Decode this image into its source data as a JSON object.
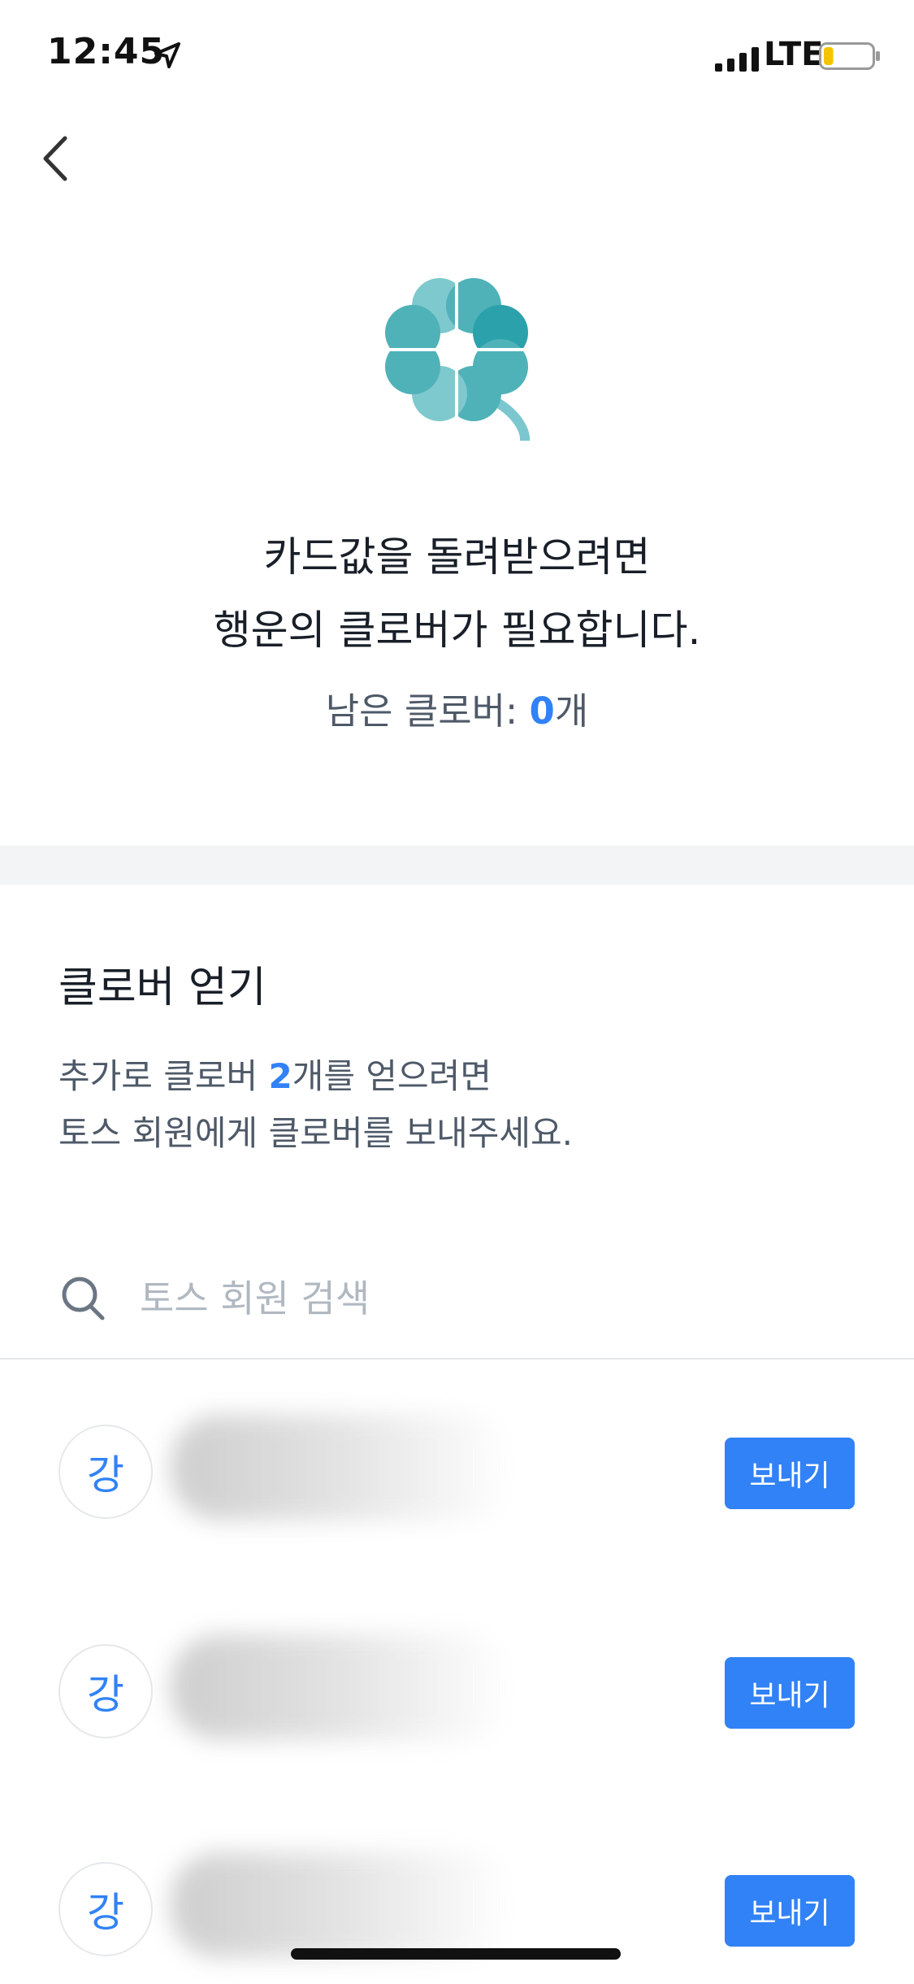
{
  "status_bar": {
    "time": "12:45",
    "network": "LTE",
    "location_icon": "location-arrow-icon",
    "battery_level": 0.2
  },
  "nav": {
    "back_icon": "chevron-left-icon"
  },
  "hero": {
    "icon": "clover-icon",
    "headline_line1": "카드값을 돌려받으려면",
    "headline_line2": "행운의 클로버가 필요합니다.",
    "remaining_label": "남은 클로버: ",
    "remaining_count": "0",
    "remaining_unit": "개"
  },
  "section": {
    "title": "클로버 얻기",
    "desc_line1_prefix": "추가로 클로버 ",
    "desc_line1_count": "2",
    "desc_line1_suffix": "개를 얻으려면",
    "desc_line2": "토스 회원에게 클로버를 보내주세요."
  },
  "search": {
    "placeholder": "토스 회원 검색",
    "value": ""
  },
  "contacts": [
    {
      "initial": "강",
      "send_label": "보내기"
    },
    {
      "initial": "강",
      "send_label": "보내기"
    },
    {
      "initial": "강",
      "send_label": "보내기"
    }
  ],
  "colors": {
    "accent": "#3182f6",
    "text_primary": "#191f28",
    "text_secondary": "#4e5968",
    "placeholder": "#b0b8c1",
    "clover": "#4fb2b8"
  }
}
